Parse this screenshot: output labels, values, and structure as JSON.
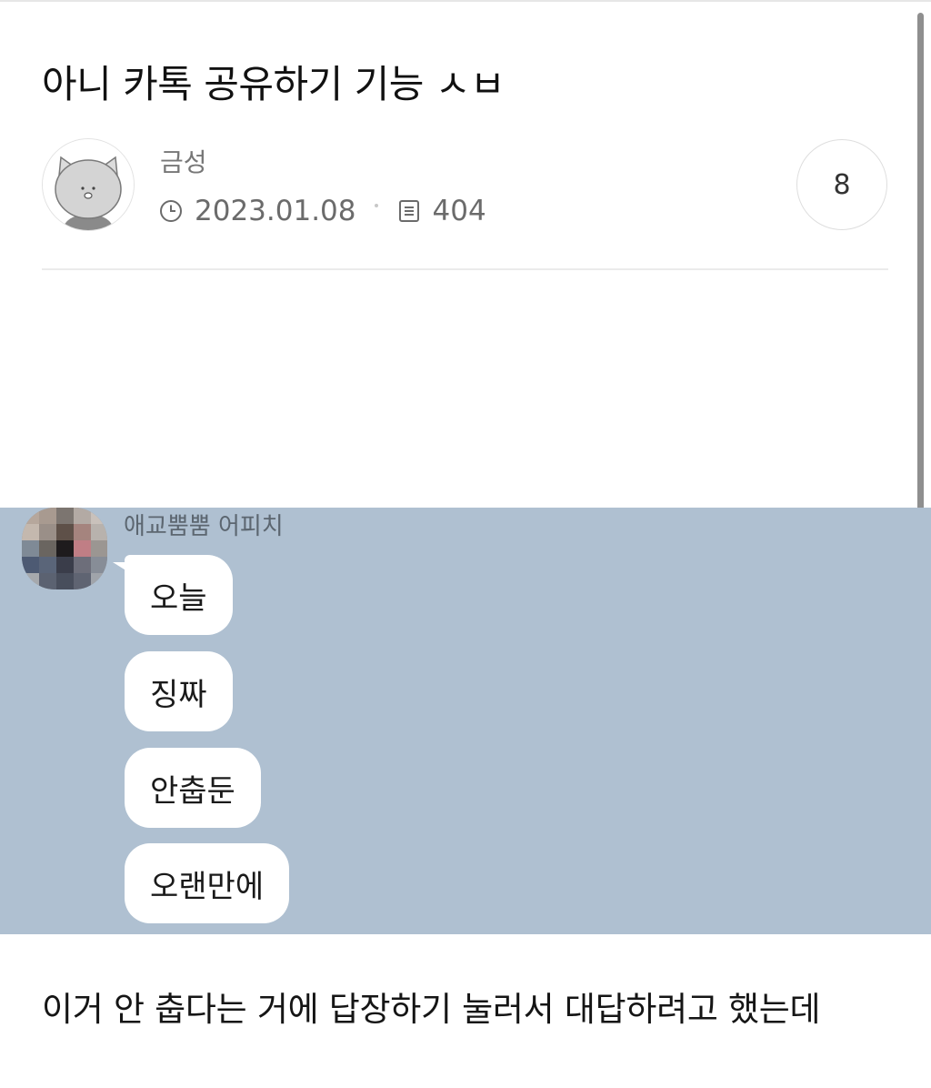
{
  "post": {
    "title": "아니 카톡 공유하기 기능 ㅅㅂ",
    "author": "금성",
    "date": "2023.01.08",
    "views": "404",
    "comment_count": "8",
    "body_text": "이거 안 춥다는 거에 답장하기 눌러서 대답하려고 했는데"
  },
  "icons": {
    "avatar": "cat-avatar-icon",
    "date": "clock-icon",
    "views": "document-icon"
  },
  "chat": {
    "background_color": "#afc0d1",
    "sender_name": "애교뿜뿜 어피치",
    "messages": [
      "오늘",
      "징짜",
      "안춥둔",
      "오랜만에"
    ]
  }
}
